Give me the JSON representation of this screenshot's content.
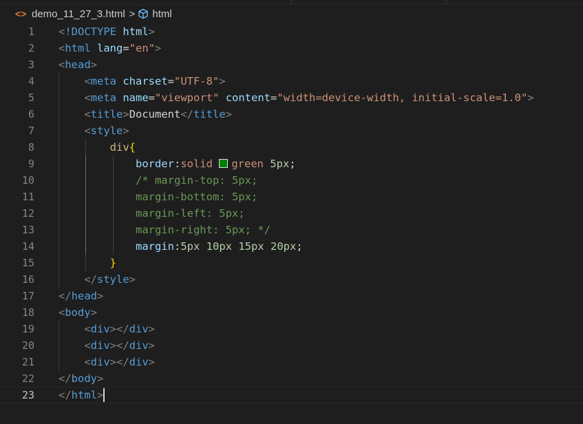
{
  "breadcrumb": {
    "file_icon": "file-code-icon",
    "file_name": "demo_11_27_3.html",
    "separator": ">",
    "symbol_icon": "symbol-element-icon",
    "symbol_name": "html"
  },
  "editor": {
    "current_line": 23,
    "colors": {
      "swatch_green": "#008000"
    },
    "lines": [
      {
        "n": "1",
        "tokens": [
          [
            "punc",
            "<"
          ],
          [
            "tag",
            "!DOCTYPE"
          ],
          [
            "plain",
            " "
          ],
          [
            "attr",
            "html"
          ],
          [
            "punc",
            ">"
          ]
        ]
      },
      {
        "n": "2",
        "tokens": [
          [
            "punc",
            "<"
          ],
          [
            "tag",
            "html"
          ],
          [
            "plain",
            " "
          ],
          [
            "attr",
            "lang"
          ],
          [
            "plain",
            "="
          ],
          [
            "str",
            "\"en\""
          ],
          [
            "punc",
            ">"
          ]
        ]
      },
      {
        "n": "3",
        "tokens": [
          [
            "punc",
            "<"
          ],
          [
            "tag",
            "head"
          ],
          [
            "punc",
            ">"
          ]
        ]
      },
      {
        "n": "4",
        "tokens": [
          [
            "plain",
            "    "
          ],
          [
            "punc",
            "<"
          ],
          [
            "tag",
            "meta"
          ],
          [
            "plain",
            " "
          ],
          [
            "attr",
            "charset"
          ],
          [
            "plain",
            "="
          ],
          [
            "str",
            "\"UTF-8\""
          ],
          [
            "punc",
            ">"
          ]
        ]
      },
      {
        "n": "5",
        "tokens": [
          [
            "plain",
            "    "
          ],
          [
            "punc",
            "<"
          ],
          [
            "tag",
            "meta"
          ],
          [
            "plain",
            " "
          ],
          [
            "attr",
            "name"
          ],
          [
            "plain",
            "="
          ],
          [
            "str",
            "\"viewport\""
          ],
          [
            "plain",
            " "
          ],
          [
            "attr",
            "content"
          ],
          [
            "plain",
            "="
          ],
          [
            "str",
            "\"width=device-width, initial-scale=1.0\""
          ],
          [
            "punc",
            ">"
          ]
        ]
      },
      {
        "n": "6",
        "tokens": [
          [
            "plain",
            "    "
          ],
          [
            "punc",
            "<"
          ],
          [
            "tag",
            "title"
          ],
          [
            "punc",
            ">"
          ],
          [
            "text",
            "Document"
          ],
          [
            "punc",
            "</"
          ],
          [
            "tag",
            "title"
          ],
          [
            "punc",
            ">"
          ]
        ]
      },
      {
        "n": "7",
        "tokens": [
          [
            "plain",
            "    "
          ],
          [
            "punc",
            "<"
          ],
          [
            "tag",
            "style"
          ],
          [
            "punc",
            ">"
          ]
        ]
      },
      {
        "n": "8",
        "tokens": [
          [
            "plain",
            "        "
          ],
          [
            "sel",
            "div"
          ],
          [
            "brace",
            "{"
          ]
        ]
      },
      {
        "n": "9",
        "tokens": [
          [
            "plain",
            "            "
          ],
          [
            "prop",
            "border"
          ],
          [
            "plain",
            ":"
          ],
          [
            "val",
            "solid "
          ],
          [
            "swatch",
            ""
          ],
          [
            "val",
            "green"
          ],
          [
            "plain",
            " "
          ],
          [
            "num",
            "5px"
          ],
          [
            "plain",
            ";"
          ]
        ]
      },
      {
        "n": "10",
        "tokens": [
          [
            "plain",
            "            "
          ],
          [
            "comment",
            "/* margin-top: 5px;"
          ]
        ]
      },
      {
        "n": "11",
        "tokens": [
          [
            "plain",
            "            "
          ],
          [
            "comment",
            "margin-bottom: 5px;"
          ]
        ]
      },
      {
        "n": "12",
        "tokens": [
          [
            "plain",
            "            "
          ],
          [
            "comment",
            "margin-left: 5px;"
          ]
        ]
      },
      {
        "n": "13",
        "tokens": [
          [
            "plain",
            "            "
          ],
          [
            "comment",
            "margin-right: 5px; */"
          ]
        ]
      },
      {
        "n": "14",
        "tokens": [
          [
            "plain",
            "            "
          ],
          [
            "prop",
            "margin"
          ],
          [
            "plain",
            ":"
          ],
          [
            "num",
            "5px"
          ],
          [
            "plain",
            " "
          ],
          [
            "num",
            "10px"
          ],
          [
            "plain",
            " "
          ],
          [
            "num",
            "15px"
          ],
          [
            "plain",
            " "
          ],
          [
            "num",
            "20px"
          ],
          [
            "plain",
            ";"
          ]
        ]
      },
      {
        "n": "15",
        "tokens": [
          [
            "plain",
            "        "
          ],
          [
            "brace",
            "}"
          ]
        ]
      },
      {
        "n": "16",
        "tokens": [
          [
            "plain",
            "    "
          ],
          [
            "punc",
            "</"
          ],
          [
            "tag",
            "style"
          ],
          [
            "punc",
            ">"
          ]
        ]
      },
      {
        "n": "17",
        "tokens": [
          [
            "punc",
            "</"
          ],
          [
            "tag",
            "head"
          ],
          [
            "punc",
            ">"
          ]
        ]
      },
      {
        "n": "18",
        "tokens": [
          [
            "punc",
            "<"
          ],
          [
            "tag",
            "body"
          ],
          [
            "punc",
            ">"
          ]
        ]
      },
      {
        "n": "19",
        "tokens": [
          [
            "plain",
            "    "
          ],
          [
            "punc",
            "<"
          ],
          [
            "tag",
            "div"
          ],
          [
            "punc",
            "></"
          ],
          [
            "tag",
            "div"
          ],
          [
            "punc",
            ">"
          ]
        ]
      },
      {
        "n": "20",
        "tokens": [
          [
            "plain",
            "    "
          ],
          [
            "punc",
            "<"
          ],
          [
            "tag",
            "div"
          ],
          [
            "punc",
            "></"
          ],
          [
            "tag",
            "div"
          ],
          [
            "punc",
            ">"
          ]
        ]
      },
      {
        "n": "21",
        "tokens": [
          [
            "plain",
            "    "
          ],
          [
            "punc",
            "<"
          ],
          [
            "tag",
            "div"
          ],
          [
            "punc",
            "></"
          ],
          [
            "tag",
            "div"
          ],
          [
            "punc",
            ">"
          ]
        ]
      },
      {
        "n": "22",
        "tokens": [
          [
            "punc",
            "</"
          ],
          [
            "tag",
            "body"
          ],
          [
            "punc",
            ">"
          ]
        ]
      },
      {
        "n": "23",
        "tokens": [
          [
            "punc",
            "</"
          ],
          [
            "tag",
            "html"
          ],
          [
            "punc",
            ">"
          ]
        ]
      }
    ]
  }
}
